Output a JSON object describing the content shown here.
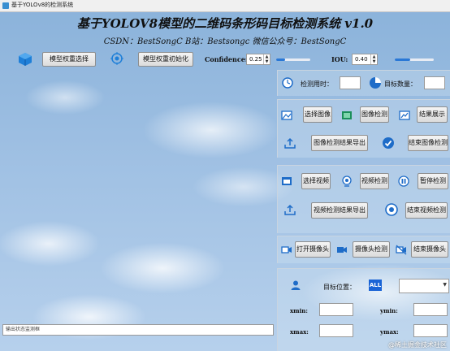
{
  "window": {
    "title": "基于YOLOv8的检测系统"
  },
  "header": {
    "title": "基于YOLOV8模型的二维码条形码目标检测系统 v1.0",
    "subtitle": "CSDN：BestSongC   B站：Bestsongc   微信公众号：BestSongC"
  },
  "toolbar": {
    "model_select_label": "模型权重选择",
    "model_init_label": "模型权重初始化",
    "confidence_label": "Confidence:",
    "confidence_value": "0.25",
    "confidence_fraction": 0.25,
    "iou_label": "IOU:",
    "iou_value": "0.40",
    "iou_fraction": 0.4
  },
  "stats": {
    "time_label": "检测用时：",
    "count_label": "目标数量："
  },
  "image_section": {
    "select_label": "选择图像",
    "detect_label": "图像检测",
    "show_label": "结果展示",
    "export_label": "图像检测结果导出",
    "end_label": "结束图像检测"
  },
  "video_section": {
    "select_label": "选择视频",
    "detect_label": "视频检测",
    "pause_label": "暂停检测",
    "export_label": "视频检测结果导出",
    "end_label": "结束视频检测"
  },
  "camera_section": {
    "open_label": "打开摄像头",
    "detect_label": "摄像头检测",
    "end_label": "结束摄像头"
  },
  "target": {
    "position_label": "目标位置：",
    "all_badge": "ALL",
    "xmin_label": "xmin:",
    "ymin_label": "ymin:",
    "xmax_label": "xmax:",
    "ymax_label": "ymax:"
  },
  "status": {
    "placeholder": "输出状态监测框"
  },
  "watermark": "@稀土掘金技术社区",
  "colors": {
    "accent": "#2a78d6",
    "badge": "#1a64d6"
  }
}
